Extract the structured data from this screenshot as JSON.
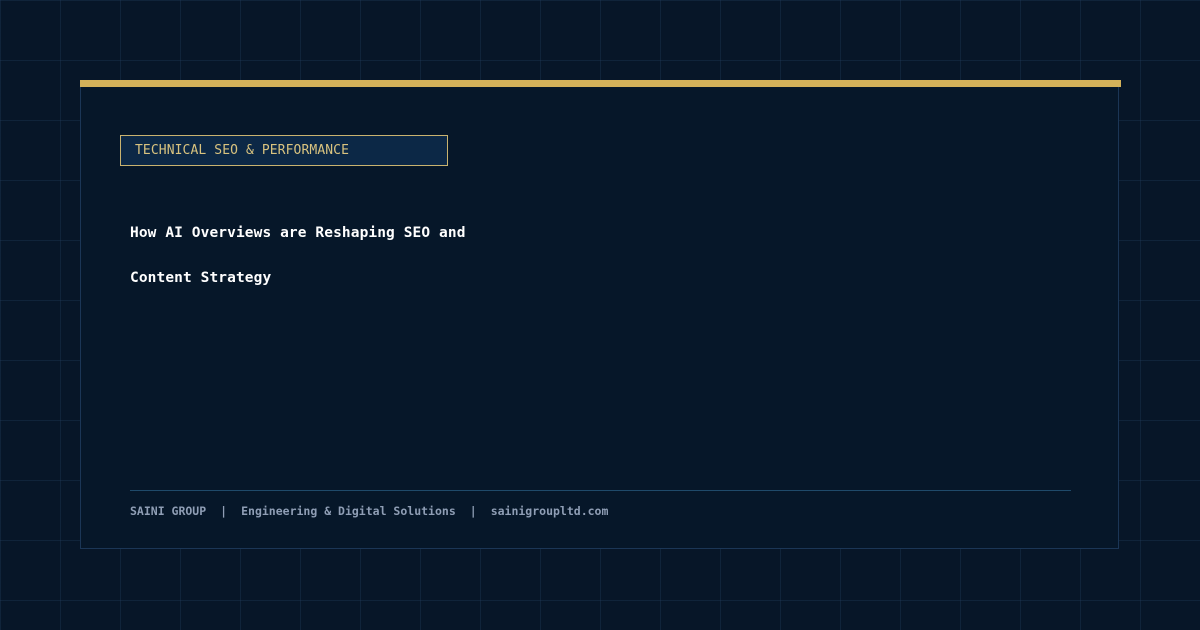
{
  "category": "TECHNICAL SEO & PERFORMANCE",
  "title": {
    "line1": "How AI Overviews are Reshaping SEO and",
    "line2": "Content Strategy"
  },
  "footer": {
    "company": "SAINI GROUP",
    "separator": "|",
    "tagline": "Engineering & Digital Solutions",
    "website": "sainigroupltd.com"
  },
  "colors": {
    "background": "#071628",
    "card": "#061729",
    "accent_gold": "#d4b25a",
    "tag_text": "#d9c37f",
    "title_text": "#ffffff",
    "footer_text": "#8f9eb5"
  }
}
